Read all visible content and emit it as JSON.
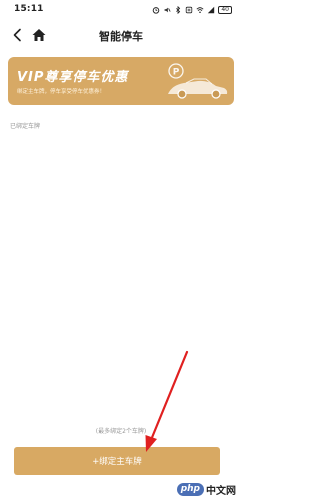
{
  "status_bar": {
    "time": "15:11",
    "battery": "40"
  },
  "nav": {
    "title": "智能停车",
    "back_icon": "chevron-left",
    "home_icon": "home"
  },
  "banner": {
    "title": "VIP尊享停车优惠",
    "subtitle": "绑定主车牌，停车享受停车优惠券！",
    "art_letter": "P"
  },
  "plates_section": {
    "label": "已绑定车牌"
  },
  "bind_hint": "(最多绑定2个车牌)",
  "bind_button": {
    "label": "+绑定主车牌"
  },
  "watermark": {
    "logo": "php",
    "text": "中文网"
  },
  "colors": {
    "accent": "#d8a963",
    "arrow": "#e02020"
  }
}
